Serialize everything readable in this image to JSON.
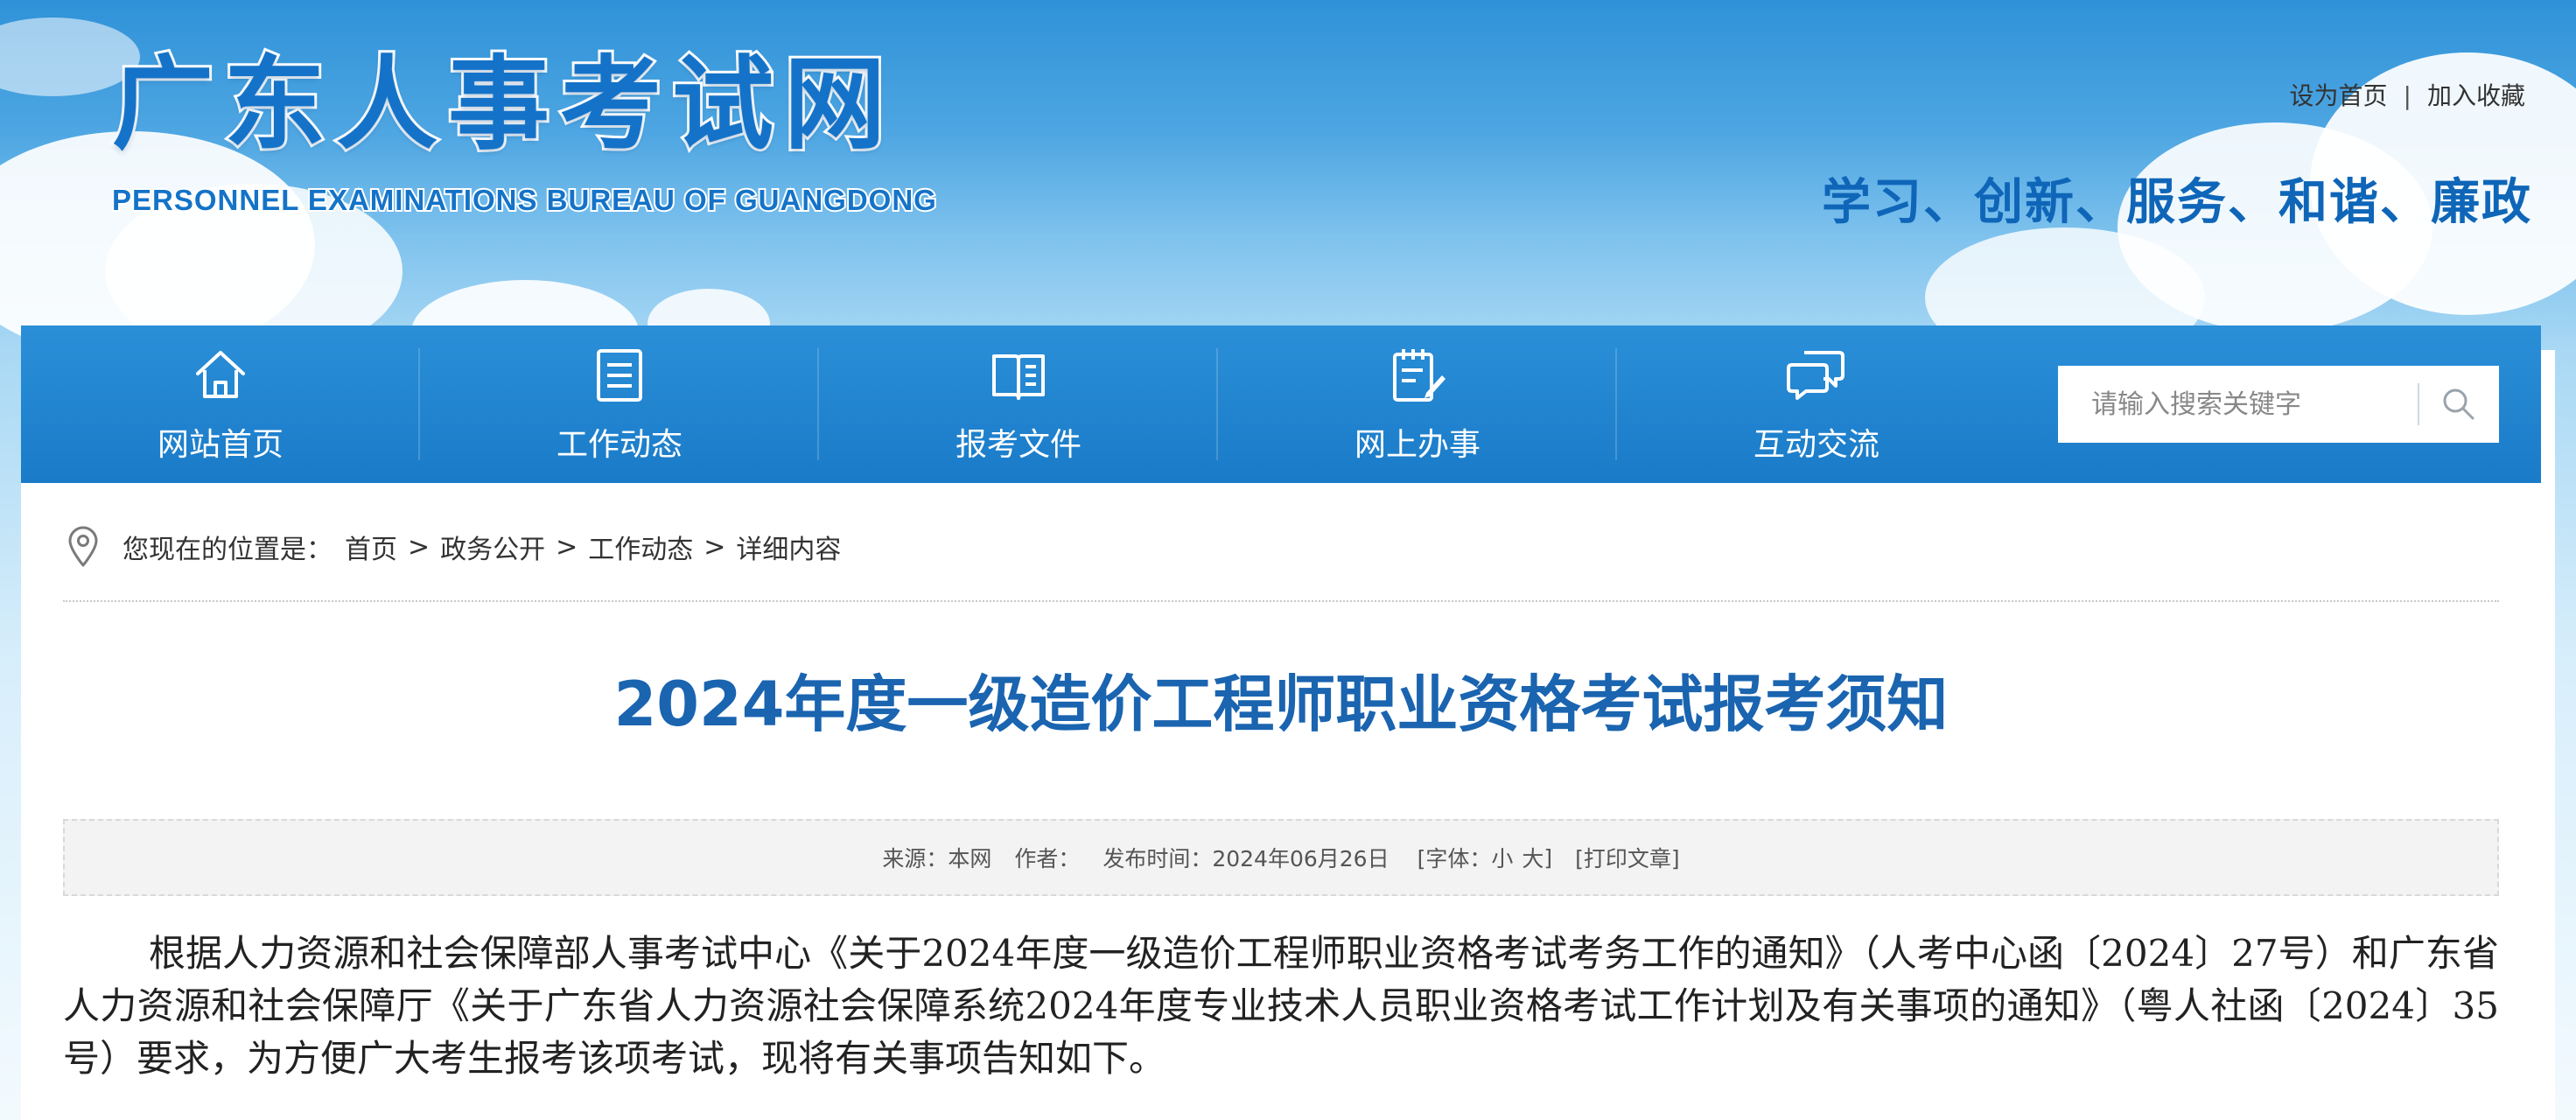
{
  "header": {
    "site_title": "广东人事考试网",
    "site_subtitle": "PERSONNEL EXAMINATIONS BUREAU OF GUANGDONG",
    "top_links": [
      "设为首页",
      "加入收藏"
    ],
    "top_link_separator": "|",
    "slogan": "学习、创新、服务、和谐、廉政"
  },
  "nav": {
    "items": [
      {
        "label": "网站首页",
        "icon": "home-icon"
      },
      {
        "label": "工作动态",
        "icon": "document-list-icon"
      },
      {
        "label": "报考文件",
        "icon": "open-book-icon"
      },
      {
        "label": "网上办事",
        "icon": "edit-form-icon"
      },
      {
        "label": "互动交流",
        "icon": "chat-bubbles-icon"
      }
    ],
    "search": {
      "placeholder": "请输入搜索关键字",
      "value": "",
      "icon": "search-icon"
    }
  },
  "breadcrumb": {
    "icon": "location-pin-icon",
    "prefix": "您现在的位置是：",
    "items": [
      "首页",
      "政务公开",
      "工作动态",
      "详细内容"
    ],
    "separator": ">"
  },
  "article": {
    "title": "2024年度一级造价工程师职业资格考试报考须知",
    "meta": {
      "source": "来源：本网",
      "author": "作者：",
      "date": "发布时间：2024年06月26日",
      "font_prefix": "[字体：",
      "font_small": "小",
      "font_large": "大",
      "font_suffix": "]",
      "print": "[打印文章]"
    },
    "paragraph": "根据人力资源和社会保障部人事考试中心《关于2024年度一级造价工程师职业资格考试考务工作的通知》（人考中心函〔2024〕27号）和广东省人力资源和社会保障厅《关于广东省人力资源社会保障系统2024年度专业技术人员职业资格考试工作计划及有关事项的通知》（粤人社函〔2024〕35号）要求，为方便广大考生报考该项考试，现将有关事项告知如下。"
  },
  "colors": {
    "nav_bg": "#1a7bc8",
    "title_blue": "#1a64b0",
    "logo_blue": "#1473c8",
    "slogan_blue": "#0f66b8"
  }
}
